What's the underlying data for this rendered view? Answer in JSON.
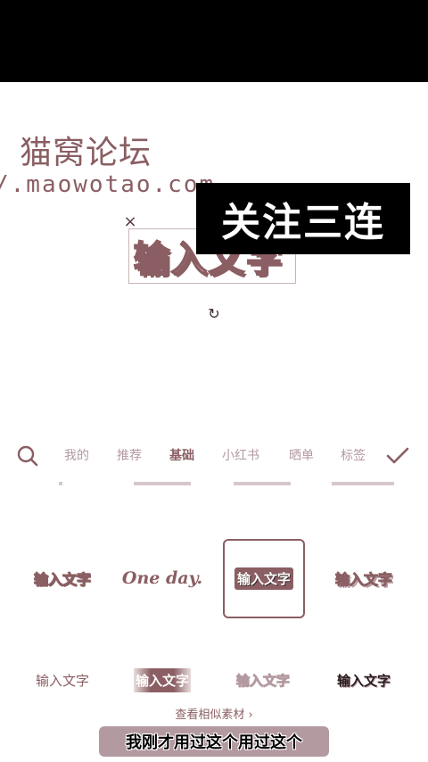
{
  "watermark": {
    "title": "猫窝论坛",
    "url": "/.maowotao.com"
  },
  "overlay": {
    "banner_text": "关注三连"
  },
  "editor": {
    "selected_text": "输入文字",
    "close_symbol": "×",
    "rotate_symbol": "↻"
  },
  "tabs": [
    {
      "label": "我的",
      "active": false
    },
    {
      "label": "推荐",
      "active": false
    },
    {
      "label": "基础",
      "active": true
    },
    {
      "label": "小红书",
      "active": false
    },
    {
      "label": "晒单",
      "active": false
    },
    {
      "label": "标签",
      "active": false
    }
  ],
  "styles_row1": [
    {
      "text": "输入文字",
      "style": "outline"
    },
    {
      "text": "One day.",
      "style": "serif"
    },
    {
      "text": "输入文字",
      "style": "badge",
      "selected": true
    },
    {
      "text": "输入文字",
      "style": "shadow"
    }
  ],
  "styles_row2": [
    {
      "text": "输入文字",
      "style": "plain"
    },
    {
      "text": "输入文字",
      "style": "gradient"
    },
    {
      "text": "输入文字",
      "style": "light"
    },
    {
      "text": "输入文字",
      "style": "dark"
    }
  ],
  "more_link": "查看相似素材 ›",
  "subtitle": "我刚才用过这个用过这个",
  "icons": {
    "search": "search-icon",
    "confirm": "check-icon",
    "close": "close-icon",
    "rotate": "rotate-icon"
  },
  "colors": {
    "accent": "#8a5e62",
    "muted": "#b39aa0",
    "banner_bg": "#000000"
  }
}
